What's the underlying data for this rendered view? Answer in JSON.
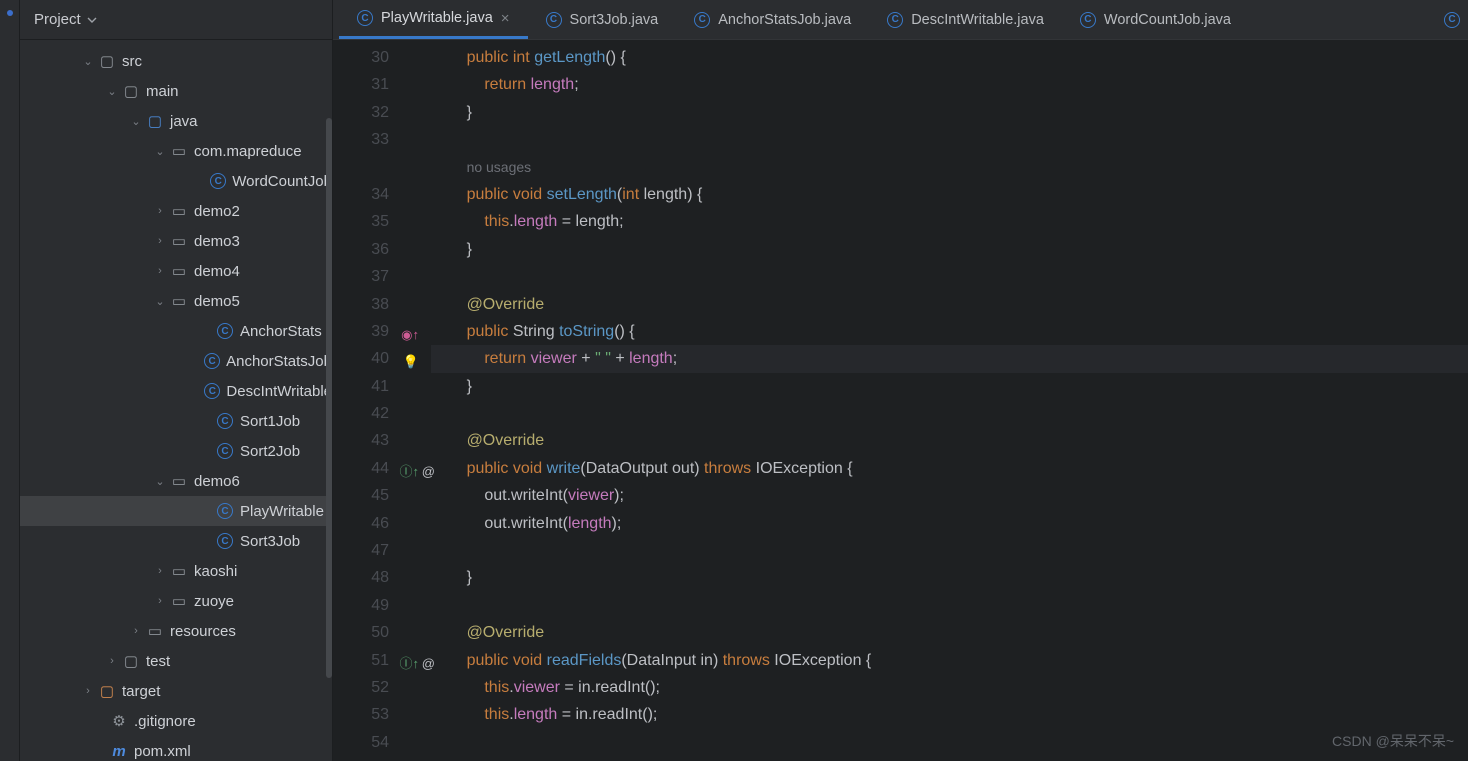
{
  "sidebar": {
    "title": "Project",
    "tree": {
      "src": "src",
      "main": "main",
      "java": "java",
      "pkg": "com.mapreduce",
      "wcj": "WordCountJob",
      "demo2": "demo2",
      "demo3": "demo3",
      "demo4": "demo4",
      "demo5": "demo5",
      "anchorstats": "AnchorStats",
      "anchorstatsjob": "AnchorStatsJob",
      "descintwritable": "DescIntWritable",
      "sort1job": "Sort1Job",
      "sort2job": "Sort2Job",
      "demo6": "demo6",
      "playwritable": "PlayWritable",
      "sort3job": "Sort3Job",
      "kaoshi": "kaoshi",
      "zuoye": "zuoye",
      "resources": "resources",
      "test": "test",
      "target": "target",
      "gitignore": ".gitignore",
      "pom": "pom.xml"
    }
  },
  "tabs": [
    {
      "label": "PlayWritable.java",
      "active": true,
      "close": true
    },
    {
      "label": "Sort3Job.java",
      "active": false
    },
    {
      "label": "AnchorStatsJob.java",
      "active": false
    },
    {
      "label": "DescIntWritable.java",
      "active": false
    },
    {
      "label": "WordCountJob.java",
      "active": false
    }
  ],
  "gutter": {
    "start": 30,
    "end": 54
  },
  "code": {
    "l30a": "public",
    "l30b": "int",
    "l30c": "getLength",
    "l30d": "() {",
    "l31a": "return",
    "l31b": "length",
    "l31c": ";",
    "l32": "}",
    "l33_hint": "no usages",
    "l34a": "public",
    "l34b": "void",
    "l34c": "setLength",
    "l34d": "(",
    "l34e": "int",
    "l34f": " length) {",
    "l35a": "this",
    "l35b": ".",
    "l35c": "length",
    "l35d": " = length;",
    "l36": "}",
    "l38": "@Override",
    "l39a": "public",
    "l39b": " String ",
    "l39c": "toString",
    "l39d": "() {",
    "l40a": "return",
    "l40b": "viewer",
    "l40c": " + ",
    "l40d": "\" \"",
    "l40e": " + ",
    "l40f": "length",
    "l40g": ";",
    "l41": "}",
    "l43": "@Override",
    "l44a": "public",
    "l44b": "void",
    "l44c": "write",
    "l44d": "(DataOutput out) ",
    "l44e": "throws",
    "l44f": " IOException {",
    "l45a": "out.writeInt(",
    "l45b": "viewer",
    "l45c": ");",
    "l46a": "out.writeInt(",
    "l46b": "length",
    "l46c": ");",
    "l48": "}",
    "l50": "@Override",
    "l51a": "public",
    "l51b": "void",
    "l51c": "readFields",
    "l51d": "(DataInput in) ",
    "l51e": "throws",
    "l51f": " IOException {",
    "l52a": "this",
    "l52b": ".",
    "l52c": "viewer",
    "l52d": " = in.readInt();",
    "l53a": "this",
    "l53b": ".",
    "l53c": "length",
    "l53d": " = in.readInt();"
  },
  "watermark": "CSDN @呆呆不呆~"
}
